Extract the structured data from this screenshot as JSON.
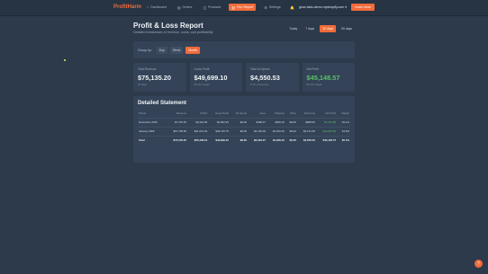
{
  "header": {
    "logo": "ProfitHarm",
    "nav": [
      {
        "icon": "⌂",
        "label": "Dashboard",
        "active": false
      },
      {
        "icon": "▤",
        "label": "Orders",
        "active": false
      },
      {
        "icon": "◫",
        "label": "Products",
        "active": false
      },
      {
        "icon": "▥",
        "label": "P&L Report",
        "active": true
      },
      {
        "icon": "⚙",
        "label": "Settings",
        "active": false
      }
    ],
    "bell_icon": "🔔",
    "store": "glow-labs-demo.myshopify.com ▾",
    "learn_label": "Learn more"
  },
  "page": {
    "title": "Profit & Loss Report",
    "subtitle": "Detailed breakdown of revenue, costs, and profitability"
  },
  "range": [
    {
      "label": "Today",
      "active": false
    },
    {
      "label": "7 days",
      "active": false
    },
    {
      "label": "30 days",
      "active": true
    },
    {
      "label": "90 days",
      "active": false
    }
  ],
  "group_by": {
    "label": "Group by:",
    "options": [
      {
        "label": "Day",
        "active": false
      },
      {
        "label": "Week",
        "active": false
      },
      {
        "label": "Month",
        "active": true
      }
    ]
  },
  "kpis": [
    {
      "label": "Total Revenue",
      "value": "$75,135.20",
      "sub": "30 days",
      "green": false
    },
    {
      "label": "Gross Profit",
      "value": "$49,699.10",
      "sub": "66.1% margin",
      "green": false
    },
    {
      "label": "Total Ad Spend",
      "value": "$4,550.53",
      "sub": "6.1% of revenue",
      "green": false
    },
    {
      "label": "Net Profit",
      "value": "$45,148.57",
      "sub": "60.1% margin",
      "green": true
    }
  ],
  "statement": {
    "title": "Detailed Statement",
    "columns": [
      "Period",
      "Revenue",
      "COGS",
      "Gross Profit",
      "Ad Spend",
      "Fees",
      "Shipping",
      "Other",
      "Total Cost",
      "Net Profit",
      "Margin"
    ],
    "rows": [
      {
        "cells": [
          "December 2025",
          "$7,375.25",
          "$4,422.90",
          "$2,952.35",
          "$0.00",
          "$468.37",
          "$390.16",
          "$0.00",
          "$808.50",
          "$2,143.85",
          "29.1%"
        ],
        "total": false
      },
      {
        "cells": [
          "January 2026",
          "$67,759.95",
          "$21,013.20",
          "$46,746.75",
          "$0.00",
          "$2,126.00",
          "$1,616.20",
          "$0.00",
          "$3,741.95",
          "$43,004.80",
          "63.5%"
        ],
        "total": false
      },
      {
        "cells": [
          "Total",
          "$75,135.20",
          "$25,436.10",
          "$49,699.10",
          "$0.00",
          "$2,594.37",
          "$1,956.16",
          "$0.00",
          "$4,550.53",
          "$45,148.57",
          "60.1%"
        ],
        "total": true
      }
    ]
  },
  "fab_icon": "?"
}
